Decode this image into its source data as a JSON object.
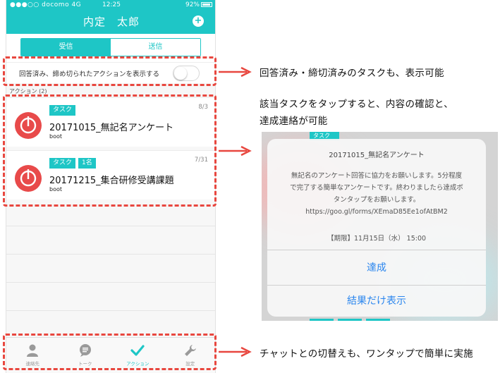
{
  "status_bar": {
    "carrier": "●●●○○ docomo",
    "network": "4G",
    "time": "12:25",
    "battery": "92%"
  },
  "header": {
    "title": "内定　太郎",
    "compose_icon": "plus-circle-icon"
  },
  "tabs": [
    {
      "label": "受信",
      "active": true
    },
    {
      "label": "送信",
      "active": false
    }
  ],
  "toggle": {
    "label": "回答済み、締め切られたアクションを表示する",
    "on": false
  },
  "section": {
    "header": "アクション (2)"
  },
  "actions": [
    {
      "badges": [
        "タスク"
      ],
      "date": "8/3",
      "title": "20171015_無記名アンケート",
      "sender": "boot"
    },
    {
      "badges": [
        "タスク",
        "1名"
      ],
      "date": "7/31",
      "title": "20171215_集合研修受講課題",
      "sender": "boot"
    }
  ],
  "tabbar": [
    {
      "label": "連絡先",
      "icon": "contact-icon",
      "active": false
    },
    {
      "label": "トーク",
      "icon": "talk-bubble-icon",
      "active": false
    },
    {
      "label": "アクション",
      "icon": "checkmark-icon",
      "active": true
    },
    {
      "label": "設定",
      "icon": "wrench-icon",
      "active": false
    }
  ],
  "annotations": {
    "note1": "回答済み・締切済みのタスクも、表示可能",
    "note2_line1": "該当タスクをタップすると、内容の確認と、",
    "note2_line2": "達成連絡が可能",
    "note3": "チャットとの切替えも、ワンタップで簡単に実施"
  },
  "dialog": {
    "behind_tag": "タスク",
    "title": "20171015_無記名アンケート",
    "body_lines": [
      "無記名のアンケート回答に協力をお願いします。5分程度",
      "で完了する簡単なアンケートです。終わりましたら達成ボ",
      "タンタップをお願いします。",
      "https://goo.gl/forms/XEmaD85Ee1ofAtBM2"
    ],
    "deadline": "【期限】11月15日（水） 15:00",
    "primary_button": "達成",
    "secondary_button": "結果だけ表示"
  },
  "colors": {
    "accent": "#1ec6c6",
    "avatar": "#e84a4a",
    "callout": "#e8473f",
    "dialog_button": "#2b86ee"
  }
}
